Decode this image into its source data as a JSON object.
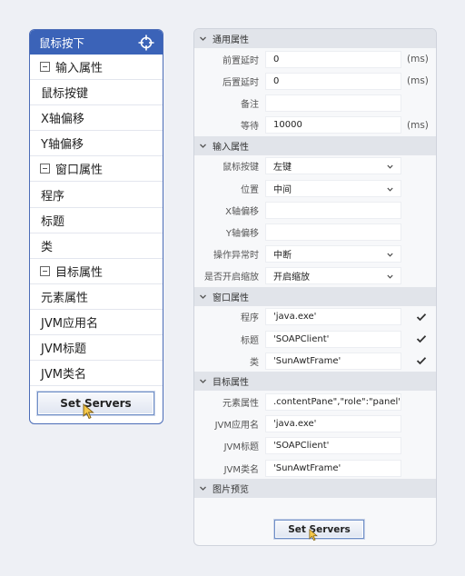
{
  "left_panel": {
    "title": "鼠标按下",
    "rows": [
      {
        "label": "输入属性",
        "group": true
      },
      {
        "label": "鼠标按键",
        "group": false
      },
      {
        "label": "X轴偏移",
        "group": false
      },
      {
        "label": "Y轴偏移",
        "group": false
      },
      {
        "label": "窗口属性",
        "group": true
      },
      {
        "label": "程序",
        "group": false
      },
      {
        "label": "标题",
        "group": false
      },
      {
        "label": "类",
        "group": false
      },
      {
        "label": "目标属性",
        "group": true
      },
      {
        "label": "元素属性",
        "group": false
      },
      {
        "label": "JVM应用名",
        "group": false
      },
      {
        "label": "JVM标题",
        "group": false
      },
      {
        "label": "JVM类名",
        "group": false
      }
    ],
    "button_label": "Set Servers"
  },
  "right_panel": {
    "sections": [
      {
        "title": "通用属性",
        "rows": [
          {
            "label": "前置延时",
            "value": "0",
            "unit": "(ms)"
          },
          {
            "label": "后置延时",
            "value": "0",
            "unit": "(ms)"
          },
          {
            "label": "备注",
            "value": ""
          },
          {
            "label": "等待",
            "value": "10000",
            "unit": "(ms)"
          }
        ]
      },
      {
        "title": "输入属性",
        "rows": [
          {
            "label": "鼠标按键",
            "value": "左键",
            "select": true
          },
          {
            "label": "位置",
            "value": "中间",
            "select": true
          },
          {
            "label": "X轴偏移",
            "value": ""
          },
          {
            "label": "Y轴偏移",
            "value": ""
          },
          {
            "label": "操作异常时",
            "value": "中断",
            "select": true
          },
          {
            "label": "是否开启缩放",
            "value": "开启缩放",
            "select": true
          }
        ]
      },
      {
        "title": "窗口属性",
        "rows": [
          {
            "label": "程序",
            "value": "'java.exe'",
            "checked": true
          },
          {
            "label": "标题",
            "value": "'SOAPClient'",
            "checked": true
          },
          {
            "label": "类",
            "value": "'SunAwtFrame'",
            "checked": true
          }
        ]
      },
      {
        "title": "目标属性",
        "rows": [
          {
            "label": "元素属性",
            "value": ".contentPane\",\"role\":\"panel\")]"
          },
          {
            "label": "JVM应用名",
            "value": "'java.exe'"
          },
          {
            "label": "JVM标题",
            "value": "'SOAPClient'"
          },
          {
            "label": "JVM类名",
            "value": "'SunAwtFrame'"
          }
        ]
      },
      {
        "title": "图片预览",
        "rows": []
      }
    ],
    "button_label": "Set Servers"
  },
  "colors": {
    "header_blue": "#3b63b8",
    "section_bg": "#e1e4ea",
    "panel_border": "#4b6cb7"
  },
  "icons": {
    "header": "crosshair-icon",
    "group_toggle": "collapse-minus-icon",
    "section_toggle": "chevron-down-icon",
    "dropdown": "dropdown-chevron-icon",
    "check": "checkmark-icon",
    "cursor": "mouse-cursor-icon"
  }
}
